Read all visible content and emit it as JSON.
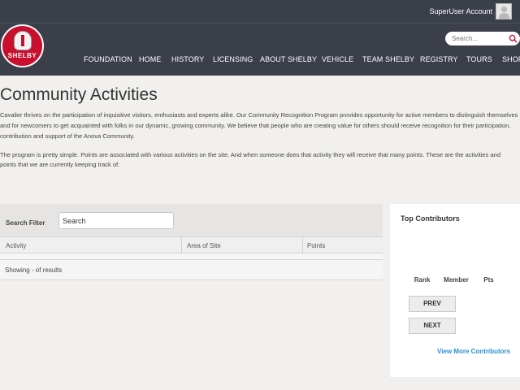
{
  "header": {
    "account_label": "SuperUser Account",
    "caret": "▾"
  },
  "logo": {
    "text": "SHELBY"
  },
  "search": {
    "placeholder": "Search..."
  },
  "nav": {
    "items": [
      {
        "label": "FOUNDATION"
      },
      {
        "label": "HOME"
      },
      {
        "label": "HISTORY"
      },
      {
        "label": "LICENSING"
      },
      {
        "label": "ABOUT SHELBY"
      },
      {
        "label": "VEHICLE"
      },
      {
        "label": "TEAM SHELBY"
      },
      {
        "label": "REGISTRY"
      },
      {
        "label": "TOURS"
      },
      {
        "label": "SHOP"
      }
    ]
  },
  "page": {
    "title": "Community Activities",
    "intro": "Cavalier thrives on the participation of inquisitive visitors, enthusiasts and experts alike. Our Community Recognition Program provides opportunity for active members to distinguish themselves and for newcomers to get acquainted with folks in our dynamic, growing community. We believe that people who are creating value for others should receive recognition for their participation, contribution and support of the Anova Community.",
    "intro2": "The program is pretty simple. Points are associated with various activities on the site. And when someone does that activity they will receive that many points. These are the activities and points that we are currently keeping track of:"
  },
  "activities": {
    "search_label": "Search Filter",
    "search_value": "Search",
    "columns": [
      "Activity",
      "Area of Site",
      "Points"
    ],
    "showing_text": "Showing - of  results"
  },
  "contributors": {
    "title": "Top Contributors",
    "columns": [
      "Rank",
      "Member",
      "Pts"
    ],
    "prev_label": "PREV",
    "next_label": "NEXT",
    "view_more": "View More Contributors"
  },
  "colors": {
    "header_bg": "#3b3f4a",
    "accent_red": "#c8102e",
    "link_blue": "#2a8fd6",
    "page_bg": "#f1f0ee"
  },
  "icons": {
    "search": "search-icon",
    "avatar": "user-avatar-icon",
    "caret": "chevron-down-icon"
  }
}
